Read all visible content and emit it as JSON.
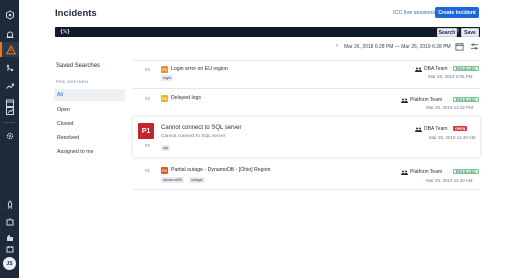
{
  "rail": {
    "icons": [
      "incidents-icon",
      "alerts-icon",
      "warning-icon",
      "integrations-icon",
      "escalation-icon",
      "schedule-icon",
      "analytics-icon",
      "settings-icon",
      "rocket-icon",
      "puzzle-icon",
      "feedback-icon"
    ],
    "avatar": "JS"
  },
  "header": {
    "title": "Incidents",
    "icc_link": "ICC live sessions",
    "create_button": "Create incident"
  },
  "search": {
    "query": "{%}",
    "help": "?",
    "search_button": "Search",
    "save_button": "Save"
  },
  "date_range": {
    "text": "Mar 26, 2018 6:28 PM — Mar 26, 2019 6:28 PM"
  },
  "saved_searches": {
    "title": "Saved Searches",
    "section": "PRE-DEFINED",
    "items": [
      "All",
      "Open",
      "Closed",
      "Resolved",
      "Assigned to me"
    ],
    "active_index": 0
  },
  "incidents": [
    {
      "number": "#4",
      "priority": "P3",
      "priority_color": "#f08a2c",
      "title": "Login error on EU region",
      "tags": [
        "login"
      ],
      "team": "DBA Team",
      "status": "RESOLVED",
      "date": "Mar 26, 2019 2:05 PM"
    },
    {
      "number": "#3",
      "priority": "P4",
      "priority_color": "#f5b324",
      "title": "Delayed logs",
      "tags": [],
      "team": "Platform Team",
      "status": "RESOLVED",
      "date": "Mar 26, 2019 12:32 PM"
    },
    {
      "number": "#2",
      "priority": "P1",
      "priority_color": "#c0262d",
      "title": "Cannot connect to SQL server",
      "subtitle": "Cannot connect to SQL server",
      "tags": [
        "sql"
      ],
      "team": "DBA Team",
      "status": "OPEN",
      "date": "Mar 25, 2019 11:40 AM"
    },
    {
      "number": "#1",
      "priority": "P2",
      "priority_color": "#e0582a",
      "title": "Partial outage - DynamoDB - [Ohio] Region",
      "tags": [
        "dynamoDB",
        "outage"
      ],
      "team": "Platform Team",
      "status": "RESOLVED",
      "date": "Mar 25, 2019 11:40 AM"
    }
  ]
}
